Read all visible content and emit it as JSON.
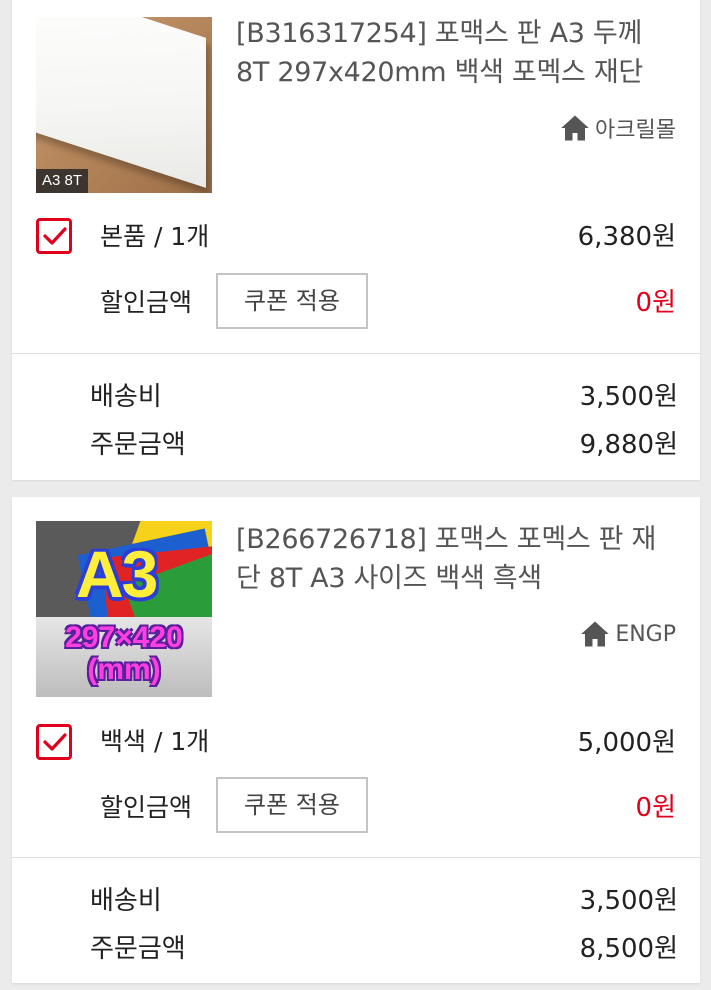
{
  "cart_items": [
    {
      "product_title": "[B316317254] 포맥스 판 A3 두께 8T 297x420mm 백색 포멕스 재단",
      "thumbnail_caption": "A3 8T",
      "seller": "아크릴몰",
      "seller_icon": "home-icon",
      "checked": true,
      "option": "본품 / 1개",
      "price": "6,380원",
      "discount_label": "할인금액",
      "coupon_button": "쿠폰 적용",
      "discount_amount": "0원",
      "shipping_label": "배송비",
      "shipping_fee": "3,500원",
      "order_total_label": "주문금액",
      "order_total": "9,880원"
    },
    {
      "product_title": "[B266726718] 포맥스 포멕스 판 재단 8T A3 사이즈 백색 흑색",
      "thumbnail_text": "A3",
      "thumbnail_size_line1": "297×420",
      "thumbnail_size_line2": "(mm)",
      "seller": "ENGP",
      "seller_icon": "home-icon",
      "checked": true,
      "option": "백색 / 1개",
      "price": "5,000원",
      "discount_label": "할인금액",
      "coupon_button": "쿠폰 적용",
      "discount_amount": "0원",
      "shipping_label": "배송비",
      "shipping_fee": "3,500원",
      "order_total_label": "주문금액",
      "order_total": "8,500원"
    }
  ],
  "colors": {
    "accent_red": "#e0001b",
    "text_dark": "#222222",
    "text_muted": "#555555",
    "page_bg": "#ebebeb"
  }
}
